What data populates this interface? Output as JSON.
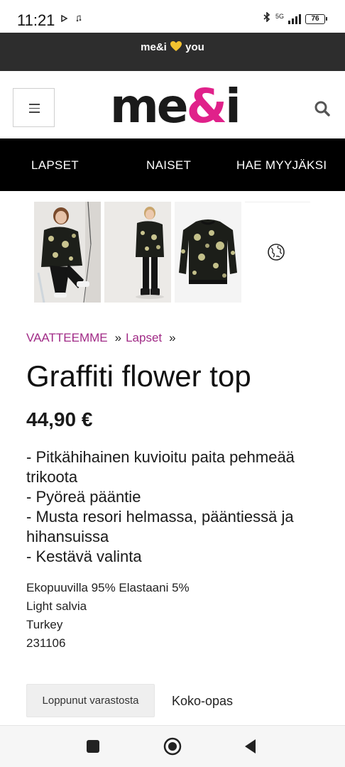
{
  "status_bar": {
    "time": "11:21",
    "network": "5G",
    "battery": "76"
  },
  "promo": {
    "text_before": "me&i",
    "text_after": "you"
  },
  "header": {
    "logo_part1": "me",
    "logo_part2": "&",
    "logo_part3": "i"
  },
  "nav": {
    "items": [
      "LAPSET",
      "NAISET",
      "HAE MYYJÄKSI"
    ]
  },
  "breadcrumb": {
    "items": [
      "VAATTEEMME",
      "Lapset"
    ],
    "separator": "»"
  },
  "product": {
    "title": "Graffiti flower top",
    "price": "44,90 €",
    "description": [
      "- Pitkähihainen kuvioitu paita pehmeää trikoota",
      "- Pyöreä pääntie",
      "- Musta resori helmassa, pääntiessä ja hihansuissa",
      "- Kestävä valinta"
    ],
    "details": [
      "Ekopuuvilla 95% Elastaani 5%",
      "Light salvia",
      "Turkey",
      "231106"
    ],
    "soldout_label": "Loppunut varastosta",
    "size_guide_label": "Koko-opas"
  },
  "colors": {
    "accent": "#e0218a",
    "breadcrumb": "#a02a86",
    "nav_bg": "#000000",
    "promo_bg": "#2d2d2d",
    "heart": "#f2c230"
  }
}
